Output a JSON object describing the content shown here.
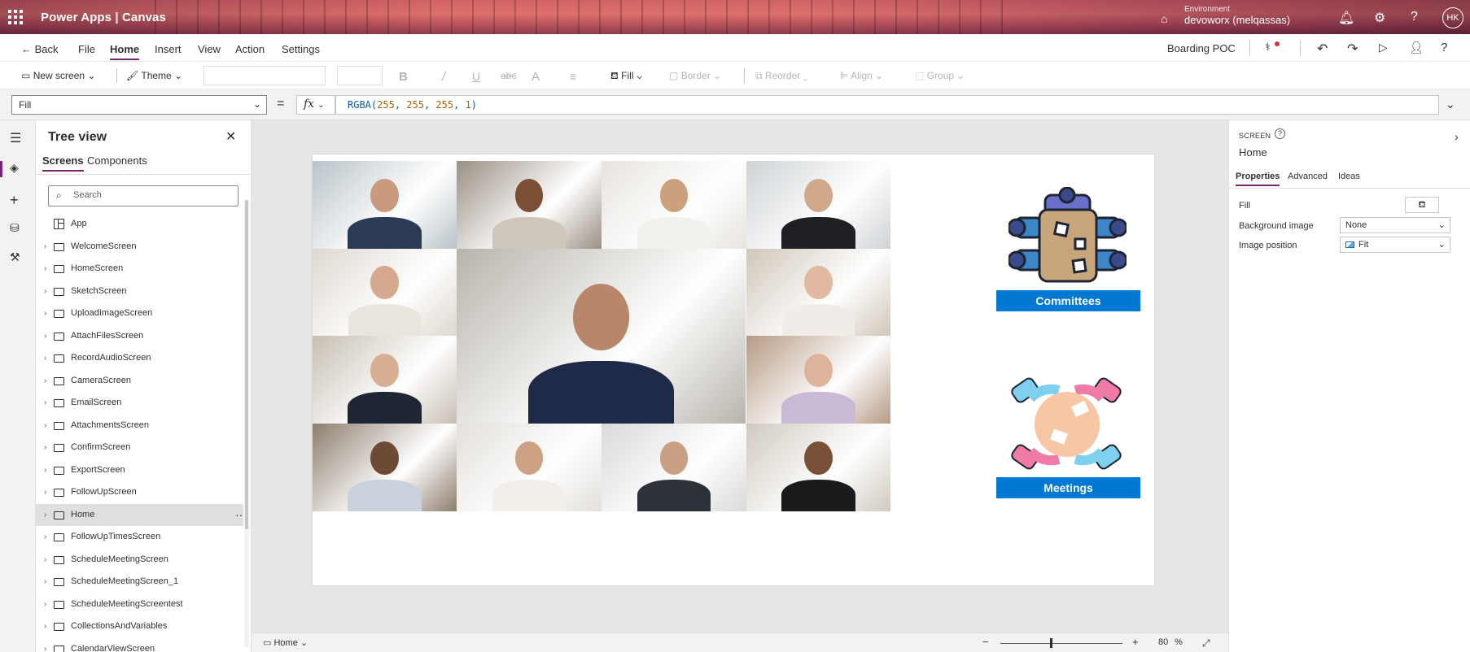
{
  "titlebar": {
    "app_name": "Power Apps  |  Canvas",
    "environment_label": "Environment",
    "environment_value": "devoworx (melqassas)",
    "user_initials": "HK"
  },
  "menubar": {
    "back": "Back",
    "items": [
      "File",
      "Home",
      "Insert",
      "View",
      "Action",
      "Settings"
    ],
    "active": "Home",
    "app_title": "Boarding POC"
  },
  "ribbon": {
    "new_screen": "New screen",
    "theme": "Theme",
    "fill": "Fill",
    "border": "Border",
    "reorder": "Reorder",
    "align": "Align",
    "group": "Group"
  },
  "formula_bar": {
    "property": "Fill",
    "equals": "=",
    "fx": "fx",
    "formula_fn": "RGBA(",
    "formula_args": [
      "255",
      "255",
      "255",
      "1"
    ],
    "formula_close": ")"
  },
  "tree_view": {
    "title": "Tree view",
    "tabs": [
      "Screens",
      "Components"
    ],
    "active_tab": "Screens",
    "search_placeholder": "Search",
    "items": [
      {
        "label": "App",
        "type": "app"
      },
      {
        "label": "WelcomeScreen",
        "type": "screen"
      },
      {
        "label": "HomeScreen",
        "type": "screen"
      },
      {
        "label": "SketchScreen",
        "type": "screen"
      },
      {
        "label": "UploadImageScreen",
        "type": "screen"
      },
      {
        "label": "AttachFilesScreen",
        "type": "screen"
      },
      {
        "label": "RecordAudioScreen",
        "type": "screen"
      },
      {
        "label": "CameraScreen",
        "type": "screen"
      },
      {
        "label": "EmailScreen",
        "type": "screen"
      },
      {
        "label": "AttachmentsScreen",
        "type": "screen"
      },
      {
        "label": "ConfirmScreen",
        "type": "screen"
      },
      {
        "label": "ExportScreen",
        "type": "screen"
      },
      {
        "label": "FollowUpScreen",
        "type": "screen"
      },
      {
        "label": "Home",
        "type": "screen",
        "selected": true
      },
      {
        "label": "FollowUpTimesScreen",
        "type": "screen"
      },
      {
        "label": "ScheduleMeetingScreen",
        "type": "screen"
      },
      {
        "label": "ScheduleMeetingScreen_1",
        "type": "screen"
      },
      {
        "label": "ScheduleMeetingScreentest",
        "type": "screen"
      },
      {
        "label": "CollectionsAndVariables",
        "type": "screen"
      },
      {
        "label": "CalendarViewScreen",
        "type": "screen"
      }
    ]
  },
  "canvas": {
    "committees_label": "Committees",
    "meetings_label": "Meetings"
  },
  "bottom_bar": {
    "screen_name": "Home",
    "zoom_value": "80",
    "zoom_unit": "%"
  },
  "properties_panel": {
    "kind": "SCREEN",
    "name": "Home",
    "tabs": [
      "Properties",
      "Advanced",
      "Ideas"
    ],
    "active_tab": "Properties",
    "fill_label": "Fill",
    "background_image_label": "Background image",
    "background_image_value": "None",
    "image_position_label": "Image position",
    "image_position_value": "Fit"
  },
  "colors": {
    "accent": "#742774",
    "button_blue": "#0078d4"
  }
}
